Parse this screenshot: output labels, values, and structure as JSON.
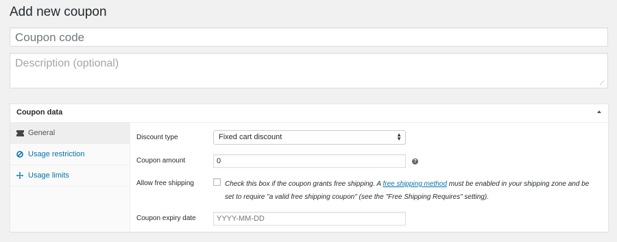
{
  "page": {
    "title": "Add new coupon",
    "code_placeholder": "Coupon code",
    "description_placeholder": "Description (optional)"
  },
  "panel": {
    "title": "Coupon data",
    "tabs": [
      {
        "label": "General",
        "icon": "ticket-icon",
        "active": true
      },
      {
        "label": "Usage restriction",
        "icon": "ban-icon",
        "active": false
      },
      {
        "label": "Usage limits",
        "icon": "plus-move-icon",
        "active": false
      }
    ]
  },
  "general": {
    "discount_type_label": "Discount type",
    "discount_type_value": "Fixed cart discount",
    "coupon_amount_label": "Coupon amount",
    "coupon_amount_value": "0",
    "free_shipping_label": "Allow free shipping",
    "free_shipping_text_1": "Check this box if the coupon grants free shipping. A ",
    "free_shipping_link": "free shipping method",
    "free_shipping_text_2": " must be enabled in your shipping zone and be set to require \"a valid free shipping coupon\" (see the \"Free Shipping Requires\" setting).",
    "expiry_label": "Coupon expiry date",
    "expiry_placeholder": "YYYY-MM-DD"
  },
  "colors": {
    "link": "#0073aa",
    "background": "#f1f1f1"
  }
}
